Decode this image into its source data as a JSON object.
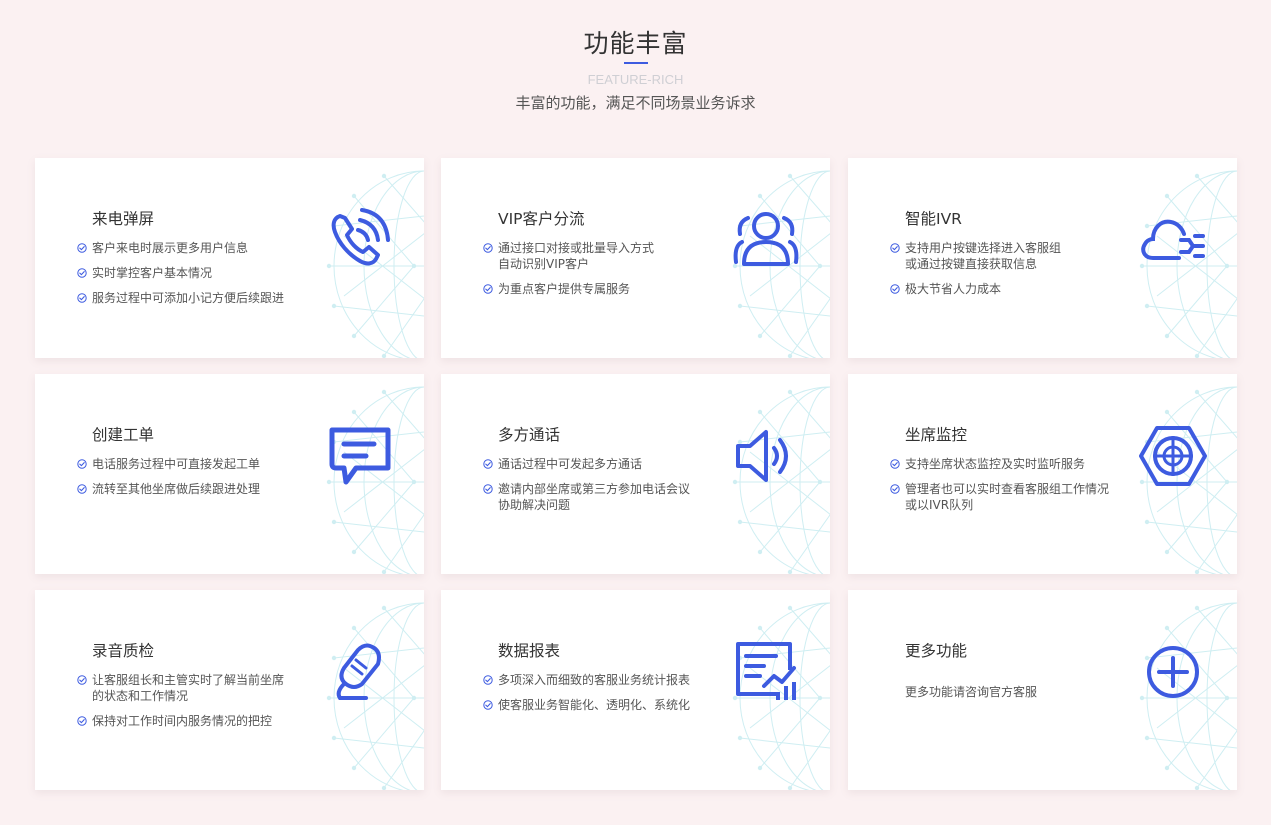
{
  "header": {
    "title": "功能丰富",
    "subtitle_en": "FEATURE-RICH",
    "subtitle_cn": "丰富的功能，满足不同场景业务诉求"
  },
  "colors": {
    "accent": "#3d5be0",
    "background": "#fbf1f2",
    "globe": "#cfeef2"
  },
  "cards": [
    {
      "title": "来电弹屏",
      "icon": "phone-ringing-icon",
      "items": [
        [
          "客户来电时展示更多用户信息"
        ],
        [
          "实时掌控客户基本情况"
        ],
        [
          "服务过程中可添加小记方便后续跟进"
        ]
      ]
    },
    {
      "title": "VIP客户分流",
      "icon": "user-group-icon",
      "items": [
        [
          "通过接口对接或批量导入方式",
          "自动识别VIP客户"
        ],
        [
          "为重点客户提供专属服务"
        ]
      ]
    },
    {
      "title": "智能IVR",
      "icon": "cloud-route-icon",
      "items": [
        [
          "支持用户按键选择进入客服组",
          "或通过按键直接获取信息"
        ],
        [
          "极大节省人力成本"
        ]
      ]
    },
    {
      "title": "创建工单",
      "icon": "ticket-icon",
      "items": [
        [
          "电话服务过程中可直接发起工单"
        ],
        [
          "流转至其他坐席做后续跟进处理"
        ]
      ]
    },
    {
      "title": "多方通话",
      "icon": "speaker-icon",
      "items": [
        [
          "通话过程中可发起多方通话"
        ],
        [
          "邀请内部坐席或第三方参加电话会议",
          "协助解决问题"
        ]
      ]
    },
    {
      "title": "坐席监控",
      "icon": "monitor-target-icon",
      "items": [
        [
          "支持坐席状态监控及实时监听服务"
        ],
        [
          "管理者也可以实时查看客服组工作情况",
          "或以IVR队列"
        ]
      ]
    },
    {
      "title": "录音质检",
      "icon": "microphone-icon",
      "items": [
        [
          "让客服组长和主管实时了解当前坐席",
          "的状态和工作情况"
        ],
        [
          "保持对工作时间内服务情况的把控"
        ]
      ]
    },
    {
      "title": "数据报表",
      "icon": "report-chart-icon",
      "items": [
        [
          "多项深入而细致的客服业务统计报表"
        ],
        [
          "使客服业务智能化、透明化、系统化"
        ]
      ]
    },
    {
      "title": "更多功能",
      "icon": "plus-circle-icon",
      "text": "更多功能请咨询官方客服"
    }
  ]
}
